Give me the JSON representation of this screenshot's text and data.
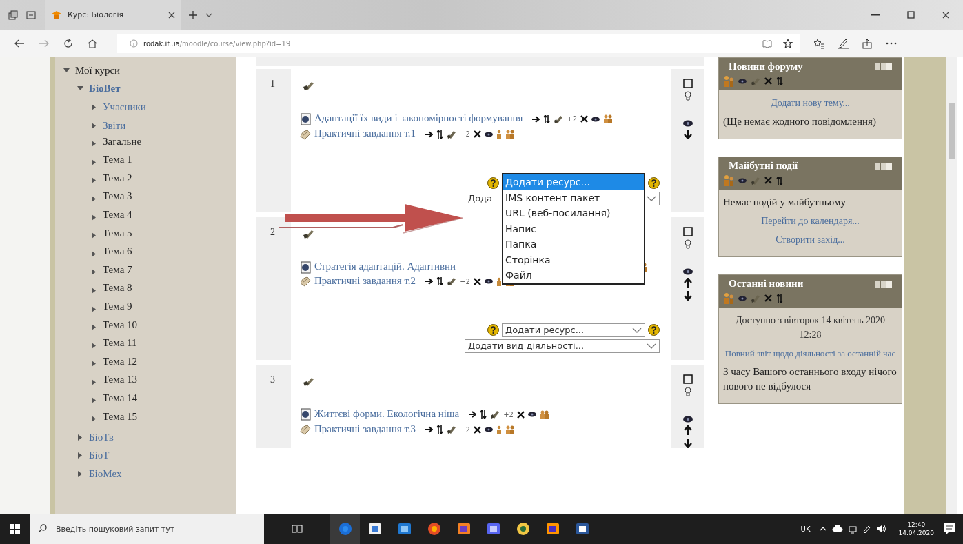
{
  "browser": {
    "tab_title": "Курс: Біологія",
    "url_host": "rodak.if.ua",
    "url_path": "/moodle/course/view.php?id=19"
  },
  "nav_tree": [
    {
      "label": "Мої курси",
      "kind": "heading",
      "expanded": true,
      "selected": false,
      "children": [
        {
          "label": "БіоВет",
          "kind": "course",
          "expanded": true,
          "selected": true,
          "children": [
            {
              "label": "Учасники",
              "kind": "link",
              "expanded": false,
              "selected": false
            },
            {
              "label": "Звіти",
              "kind": "link",
              "expanded": false,
              "selected": false
            },
            {
              "label": "Загальне",
              "kind": "section",
              "expanded": false,
              "selected": false
            },
            {
              "label": "Тема 1",
              "kind": "section",
              "expanded": false,
              "selected": false
            },
            {
              "label": "Тема 2",
              "kind": "section",
              "expanded": false,
              "selected": false
            },
            {
              "label": "Тема 3",
              "kind": "section",
              "expanded": false,
              "selected": false
            },
            {
              "label": "Тема 4",
              "kind": "section",
              "expanded": false,
              "selected": false
            },
            {
              "label": "Тема 5",
              "kind": "section",
              "expanded": false,
              "selected": false
            },
            {
              "label": "Тема 6",
              "kind": "section",
              "expanded": false,
              "selected": false
            },
            {
              "label": "Тема 7",
              "kind": "section",
              "expanded": false,
              "selected": false
            },
            {
              "label": "Тема 8",
              "kind": "section",
              "expanded": false,
              "selected": false
            },
            {
              "label": "Тема 9",
              "kind": "section",
              "expanded": false,
              "selected": false
            },
            {
              "label": "Тема 10",
              "kind": "section",
              "expanded": false,
              "selected": false
            },
            {
              "label": "Тема 11",
              "kind": "section",
              "expanded": false,
              "selected": false
            },
            {
              "label": "Тема 12",
              "kind": "section",
              "expanded": false,
              "selected": false
            },
            {
              "label": "Тема 13",
              "kind": "section",
              "expanded": false,
              "selected": false
            },
            {
              "label": "Тема 14",
              "kind": "section",
              "expanded": false,
              "selected": false
            },
            {
              "label": "Тема 15",
              "kind": "section",
              "expanded": false,
              "selected": false
            }
          ]
        },
        {
          "label": "БіоТв",
          "kind": "course",
          "expanded": false,
          "selected": false
        },
        {
          "label": "БіоТ",
          "kind": "course",
          "expanded": false,
          "selected": false
        },
        {
          "label": "БіоМех",
          "kind": "course",
          "expanded": false,
          "selected": false
        }
      ]
    }
  ],
  "sections": [
    {
      "number": "1",
      "move_up": false,
      "move_down": true,
      "resources": [
        {
          "kind": "resource",
          "title": "Адаптації їх види і закономірності формування",
          "group_mode": "+2"
        },
        {
          "kind": "assignment",
          "title": "Практичні завдання т.1",
          "group_mode": "+2"
        }
      ],
      "add_resource": {
        "open": true,
        "options": [
          {
            "label": "Додати ресурс...",
            "selected": true
          },
          {
            "label": "IMS контент пакет",
            "selected": false
          },
          {
            "label": "URL (веб-посилання)",
            "selected": false
          },
          {
            "label": "Напис",
            "selected": false
          },
          {
            "label": "Папка",
            "selected": false
          },
          {
            "label": "Сторінка",
            "selected": false
          },
          {
            "label": "Файл",
            "selected": false
          }
        ]
      },
      "add_activity": "Дода"
    },
    {
      "number": "2",
      "move_up": true,
      "move_down": true,
      "resources": [
        {
          "kind": "resource",
          "title": "Стратегія адаптацій. Адаптивни"
        },
        {
          "kind": "assignment",
          "title": "Практичні завдання т.2",
          "group_mode": "+2"
        }
      ],
      "add_resource": {
        "open": false,
        "value": "Додати ресурс..."
      },
      "add_activity": "Додати вид діяльності..."
    },
    {
      "number": "3",
      "move_up": true,
      "move_down": true,
      "resources": [
        {
          "kind": "resource",
          "title": "Життєві форми. Екологічна ніша",
          "group_mode": "+2"
        },
        {
          "kind": "assignment",
          "title": "Практичні завдання т.3",
          "group_mode": "+2"
        }
      ]
    }
  ],
  "blocks": [
    {
      "title": "Новини форуму",
      "items": [
        {
          "kind": "link",
          "text": "Додати нову тему..."
        },
        {
          "kind": "text",
          "text": "(Ще немає жодного повідомлення)"
        }
      ]
    },
    {
      "title": "Майбутні події",
      "items": [
        {
          "kind": "text",
          "text": "Немає подій у майбутньому"
        },
        {
          "kind": "link",
          "text": "Перейти до календаря..."
        },
        {
          "kind": "link",
          "text": "Створити захід..."
        }
      ]
    },
    {
      "title": "Останні новини",
      "items": [
        {
          "kind": "note",
          "text": "Доступно з вівторок 14 квітень 2020 12:28"
        },
        {
          "kind": "small_link",
          "text": "Повний звіт щодо діяльності за останній час"
        },
        {
          "kind": "text",
          "text": "З часу Вашого останнього входу нічого нового не відбулося"
        }
      ]
    }
  ],
  "taskbar": {
    "search_placeholder": "Введіть пошуковий запит тут",
    "language": "UK",
    "time": "12:40",
    "date": "14.04.2020"
  }
}
